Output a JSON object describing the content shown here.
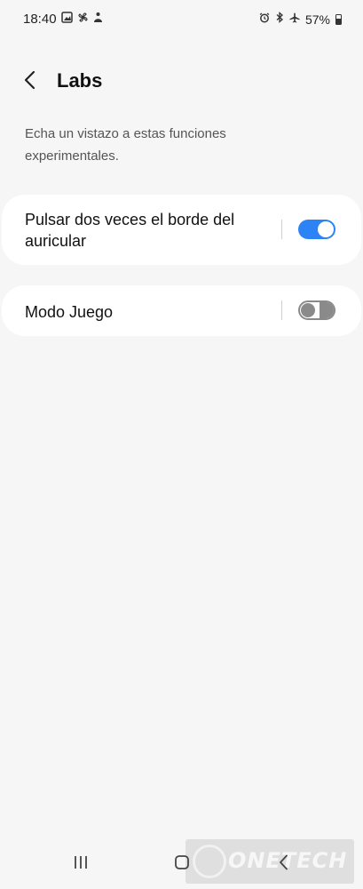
{
  "status_bar": {
    "time": "18:40",
    "battery_text": "57%",
    "left_icons": [
      "gallery-icon",
      "pinwheel-icon",
      "bixby-icon"
    ],
    "right_icons": [
      "alarm-icon",
      "bluetooth-icon",
      "airplane-icon",
      "battery-icon"
    ]
  },
  "header": {
    "title": "Labs",
    "back_icon": "chevron-left-icon"
  },
  "description": "Echa un vistazo a estas funciones experimentales.",
  "settings": [
    {
      "label": "Pulsar dos veces el borde del auricular",
      "enabled": true
    },
    {
      "label": "Modo Juego",
      "enabled": false
    }
  ],
  "nav_bar": {
    "recents_icon": "recents-icon",
    "home_icon": "home-icon",
    "back_icon": "back-icon"
  },
  "watermark": {
    "text": "ONETECH"
  },
  "colors": {
    "background": "#f6f6f6",
    "card": "#ffffff",
    "toggle_on": "#2b83f6",
    "toggle_off": "#8a8a8a"
  }
}
